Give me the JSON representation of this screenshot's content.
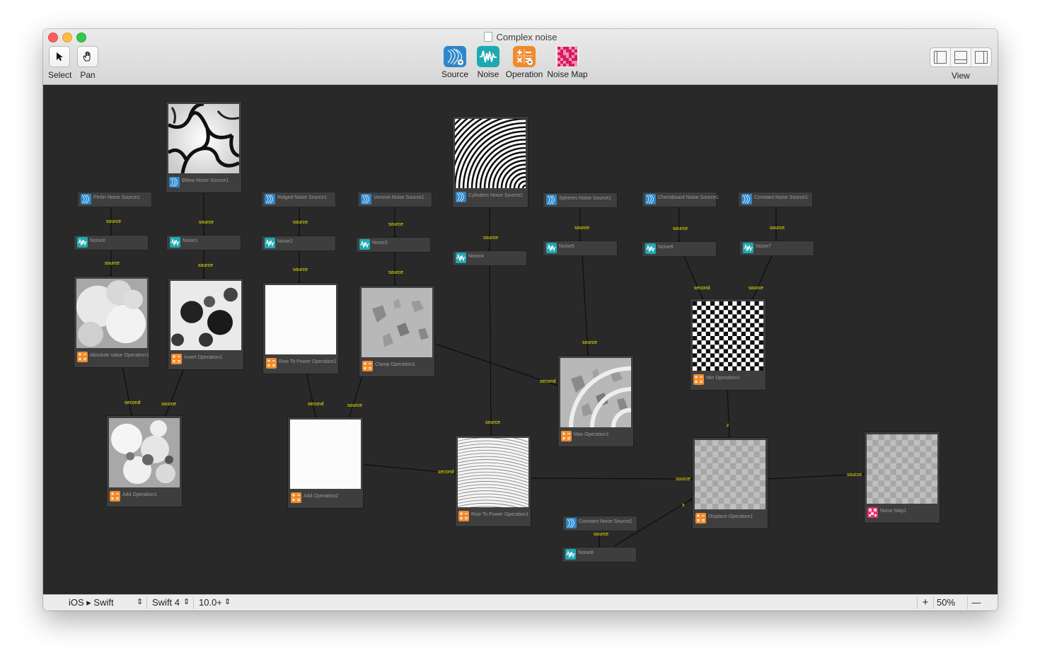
{
  "window": {
    "title": "Complex noise"
  },
  "toolbar": {
    "select_label": "Select",
    "pan_label": "Pan",
    "source_label": "Source",
    "noise_label": "Noise",
    "operation_label": "Operation",
    "noise_map_label": "Noise Map",
    "view_label": "View"
  },
  "statusbar": {
    "platform": "iOS ▸ Swift",
    "swift_version": "Swift 4",
    "os_version": "10.0+",
    "zoom": "50%",
    "zoom_in": "+",
    "zoom_out": "—"
  },
  "nodes": {
    "perlin_source": "Perlin Noise Source1",
    "billow_source": "Billow Noise Source1",
    "ridged_source": "Ridged Noise Source1",
    "voronoi_source": "Voronoi Noise Source1",
    "cylinders_source": "Cylinders Noise Source1",
    "spheres_source": "Spheres Noise Source1",
    "checkboard_source": "Checkboard Noise Source1",
    "constant_source1": "Constant Noise Source1",
    "constant_source2": "Constant Noise Source2",
    "noise0": "Noise0",
    "noise1": "Noise1",
    "noise2": "Noise2",
    "noise3": "Noise3",
    "noise4": "Noise4",
    "noise5": "Noise5",
    "noise6": "Noise6",
    "noise7": "Noise7",
    "noise8": "Noise8",
    "abs_op": "Absolute Value Operation1",
    "invert_op": "Invert Operation1",
    "power_op1": "Rise To Power Operation1",
    "clamp_op": "Clamp Operation1",
    "min_op": "Min Operation1",
    "max_op": "Max Operation1",
    "add_op1": "Add Operation1",
    "add_op2": "Add Operation2",
    "power_op2": "Rise To Power Operation1",
    "displace_op": "Displace Operation1",
    "noise_map": "Noise Map1"
  },
  "edges": {
    "source": "source",
    "second": "second",
    "x": "x",
    "z": "z"
  },
  "colors": {
    "canvas": "#292929",
    "node": "#3e3e3e",
    "edge_label": "#f3e600",
    "source_icon": "#2f86c9",
    "noise_icon": "#1da9b2",
    "operation_icon": "#ef8b2c",
    "noise_map_icon": "#e0356e"
  }
}
